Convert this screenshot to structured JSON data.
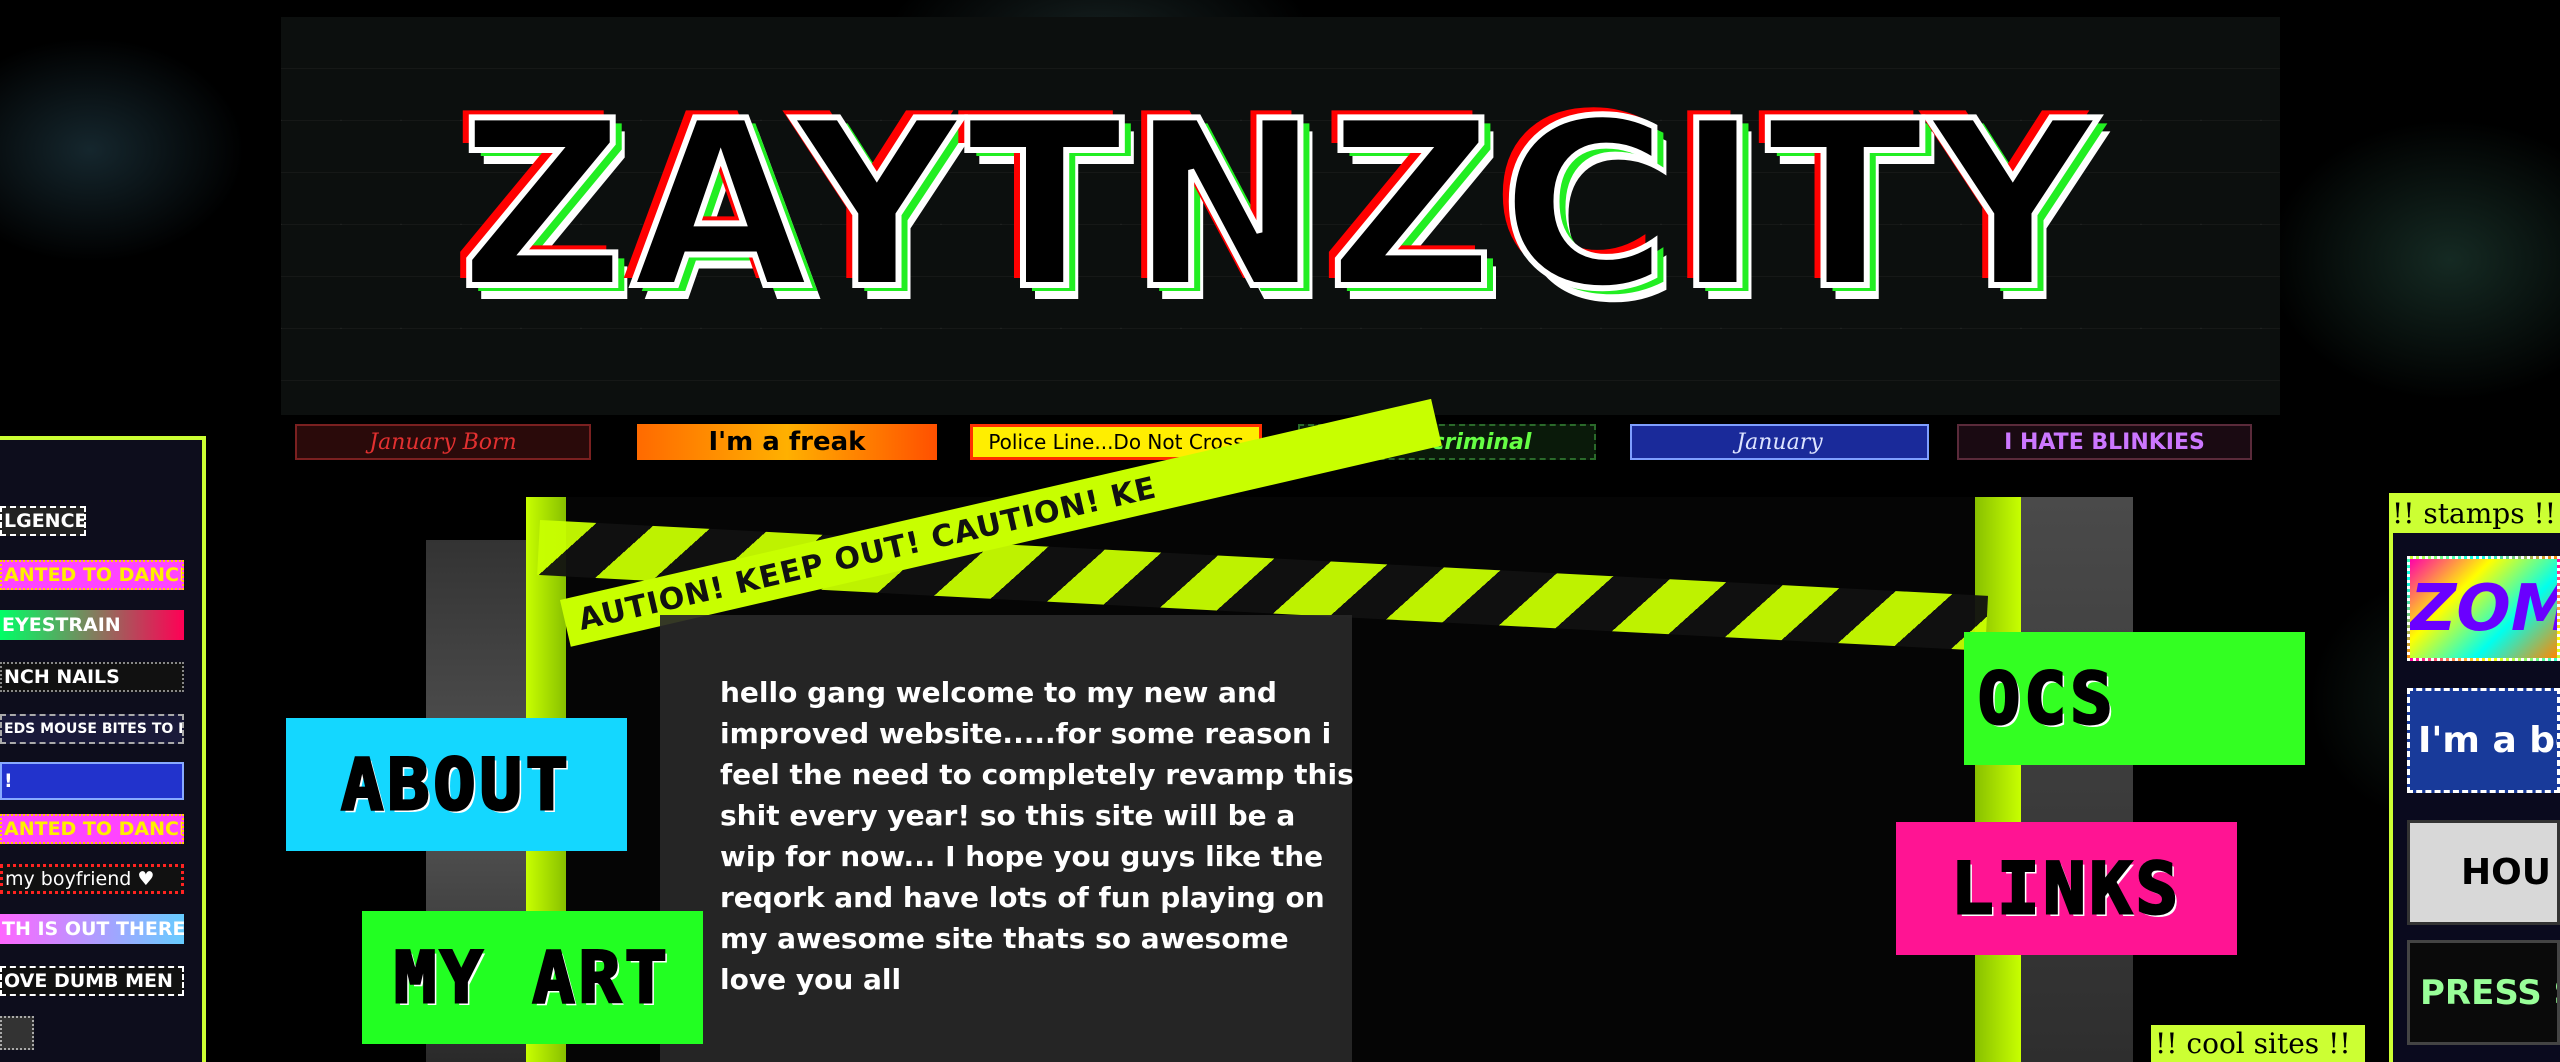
{
  "site": {
    "title": "ZAYTNZCITY"
  },
  "blinkies": [
    "January Born",
    "I'm a freak",
    "Police Line...Do Not Cross",
    "cybercriminal",
    "January",
    "I HATE BLINKIES"
  ],
  "left_sidebar": {
    "items": [
      "LGENCE",
      "ANTED TO DANCE",
      "EYESTRAIN",
      "NCH NAILS",
      "EDS MOUSE BITES TO LIVE",
      "!",
      "ANTED TO DANCE",
      "my boyfriend ♥",
      "TH IS OUT THERE",
      "OVE DUMB MEN"
    ]
  },
  "stage": {
    "tape_text": "AUTION! KEEP OUT! CAUTION! KE",
    "tape_text_upper": "UT! CAUTION! K"
  },
  "welcome": {
    "text": "hello gang welcome to my new and improved website.....for some reason i feel the need to completely revamp this shit every year! so this site will be a wip for now... I hope you guys like the reqork and have lots of fun playing on my awesome site thats so awesome love you all"
  },
  "nav": {
    "about": "ABOUT",
    "my_art": "MY ART",
    "ocs": "OCS",
    "links": "LINKS"
  },
  "right": {
    "stamps_label": "!! stamps !!",
    "cool_sites_label": "!! cool sites !!",
    "stamps": [
      "ZOMG",
      "I'm a boy",
      "HOU",
      "PRESS START"
    ]
  },
  "colors": {
    "accent_lime": "#ccff33",
    "about_bg": "#14d7ff",
    "art_bg": "#22ff22",
    "ocs_bg": "#33ff22",
    "links_bg": "#ff1493"
  }
}
